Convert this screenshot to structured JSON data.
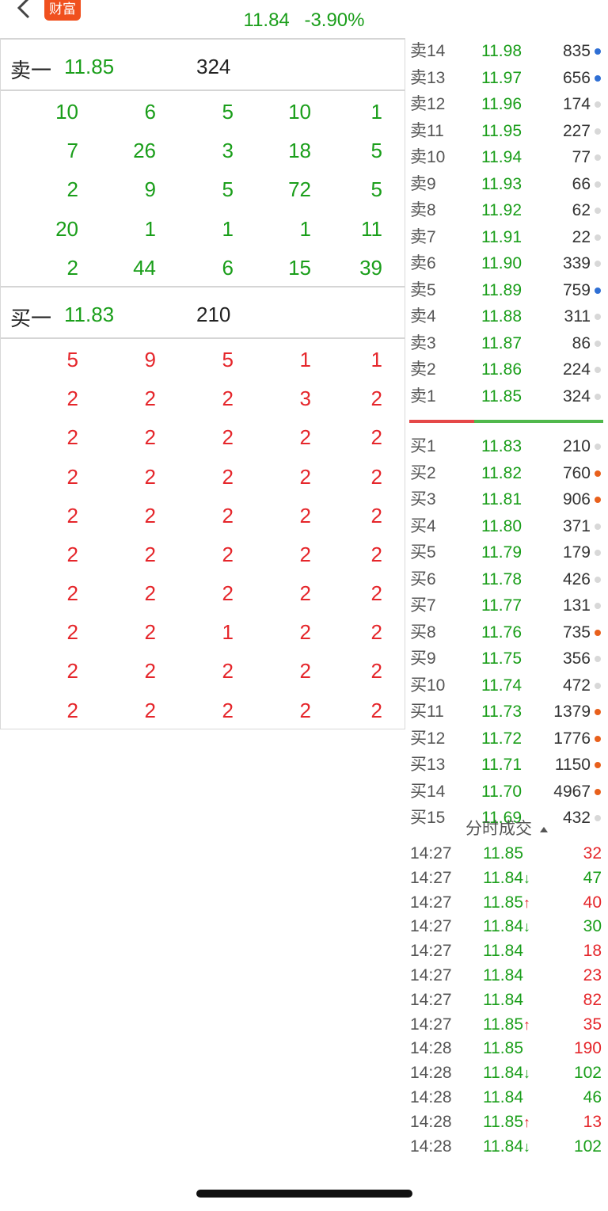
{
  "header": {
    "logo_text": "财富",
    "price": "11.84",
    "change": "-3.90%"
  },
  "sell1": {
    "label": "卖一",
    "price": "11.85",
    "volume": "324"
  },
  "buy1": {
    "label": "买一",
    "price": "11.83",
    "volume": "210"
  },
  "sell_grid": [
    [
      "10",
      "6",
      "5",
      "10",
      "1"
    ],
    [
      "7",
      "26",
      "3",
      "18",
      "5"
    ],
    [
      "2",
      "9",
      "5",
      "72",
      "5"
    ],
    [
      "20",
      "1",
      "1",
      "1",
      "11"
    ],
    [
      "2",
      "44",
      "6",
      "15",
      "39"
    ]
  ],
  "buy_grid": [
    [
      "5",
      "9",
      "5",
      "1",
      "1"
    ],
    [
      "2",
      "2",
      "2",
      "3",
      "2"
    ],
    [
      "2",
      "2",
      "2",
      "2",
      "2"
    ],
    [
      "2",
      "2",
      "2",
      "2",
      "2"
    ],
    [
      "2",
      "2",
      "2",
      "2",
      "2"
    ],
    [
      "2",
      "2",
      "2",
      "2",
      "2"
    ],
    [
      "2",
      "2",
      "2",
      "2",
      "2"
    ],
    [
      "2",
      "2",
      "1",
      "2",
      "2"
    ],
    [
      "2",
      "2",
      "2",
      "2",
      "2"
    ],
    [
      "2",
      "2",
      "2",
      "2",
      "2"
    ]
  ],
  "sell_ladder": [
    {
      "label": "卖14",
      "price": "11.98",
      "volume": "835",
      "dot": "blue"
    },
    {
      "label": "卖13",
      "price": "11.97",
      "volume": "656",
      "dot": "blue"
    },
    {
      "label": "卖12",
      "price": "11.96",
      "volume": "174",
      "dot": "gray"
    },
    {
      "label": "卖11",
      "price": "11.95",
      "volume": "227",
      "dot": "gray"
    },
    {
      "label": "卖10",
      "price": "11.94",
      "volume": "77",
      "dot": "gray"
    },
    {
      "label": "卖9",
      "price": "11.93",
      "volume": "66",
      "dot": "gray"
    },
    {
      "label": "卖8",
      "price": "11.92",
      "volume": "62",
      "dot": "gray"
    },
    {
      "label": "卖7",
      "price": "11.91",
      "volume": "22",
      "dot": "gray"
    },
    {
      "label": "卖6",
      "price": "11.90",
      "volume": "339",
      "dot": "gray"
    },
    {
      "label": "卖5",
      "price": "11.89",
      "volume": "759",
      "dot": "blue"
    },
    {
      "label": "卖4",
      "price": "11.88",
      "volume": "311",
      "dot": "gray"
    },
    {
      "label": "卖3",
      "price": "11.87",
      "volume": "86",
      "dot": "gray"
    },
    {
      "label": "卖2",
      "price": "11.86",
      "volume": "224",
      "dot": "gray"
    },
    {
      "label": "卖1",
      "price": "11.85",
      "volume": "324",
      "dot": "gray"
    }
  ],
  "buy_ladder": [
    {
      "label": "买1",
      "price": "11.83",
      "volume": "210",
      "dot": "gray"
    },
    {
      "label": "买2",
      "price": "11.82",
      "volume": "760",
      "dot": "orange"
    },
    {
      "label": "买3",
      "price": "11.81",
      "volume": "906",
      "dot": "orange"
    },
    {
      "label": "买4",
      "price": "11.80",
      "volume": "371",
      "dot": "gray"
    },
    {
      "label": "买5",
      "price": "11.79",
      "volume": "179",
      "dot": "gray"
    },
    {
      "label": "买6",
      "price": "11.78",
      "volume": "426",
      "dot": "gray"
    },
    {
      "label": "买7",
      "price": "11.77",
      "volume": "131",
      "dot": "gray"
    },
    {
      "label": "买8",
      "price": "11.76",
      "volume": "735",
      "dot": "orange"
    },
    {
      "label": "买9",
      "price": "11.75",
      "volume": "356",
      "dot": "gray"
    },
    {
      "label": "买10",
      "price": "11.74",
      "volume": "472",
      "dot": "gray"
    },
    {
      "label": "买11",
      "price": "11.73",
      "volume": "1379",
      "dot": "orange"
    },
    {
      "label": "买12",
      "price": "11.72",
      "volume": "1776",
      "dot": "orange"
    },
    {
      "label": "买13",
      "price": "11.71",
      "volume": "1150",
      "dot": "orange"
    },
    {
      "label": "买14",
      "price": "11.70",
      "volume": "4967",
      "dot": "orange"
    },
    {
      "label": "买15",
      "price": "11.69",
      "volume": "432",
      "dot": "gray"
    }
  ],
  "trades_title": "分时成交",
  "trades": [
    {
      "time": "14:27",
      "price": "11.85",
      "arrow": "",
      "volume": "32",
      "vcolor": "red"
    },
    {
      "time": "14:27",
      "price": "11.84",
      "arrow": "↓",
      "volume": "47",
      "vcolor": "green"
    },
    {
      "time": "14:27",
      "price": "11.85",
      "arrow": "↑",
      "volume": "40",
      "vcolor": "red"
    },
    {
      "time": "14:27",
      "price": "11.84",
      "arrow": "↓",
      "volume": "30",
      "vcolor": "green"
    },
    {
      "time": "14:27",
      "price": "11.84",
      "arrow": "",
      "volume": "18",
      "vcolor": "red"
    },
    {
      "time": "14:27",
      "price": "11.84",
      "arrow": "",
      "volume": "23",
      "vcolor": "red"
    },
    {
      "time": "14:27",
      "price": "11.84",
      "arrow": "",
      "volume": "82",
      "vcolor": "red"
    },
    {
      "time": "14:27",
      "price": "11.85",
      "arrow": "↑",
      "volume": "35",
      "vcolor": "red"
    },
    {
      "time": "14:28",
      "price": "11.85",
      "arrow": "",
      "volume": "190",
      "vcolor": "red"
    },
    {
      "time": "14:28",
      "price": "11.84",
      "arrow": "↓",
      "volume": "102",
      "vcolor": "green"
    },
    {
      "time": "14:28",
      "price": "11.84",
      "arrow": "",
      "volume": "46",
      "vcolor": "green"
    },
    {
      "time": "14:28",
      "price": "11.85",
      "arrow": "↑",
      "volume": "13",
      "vcolor": "red"
    },
    {
      "time": "14:28",
      "price": "11.84",
      "arrow": "↓",
      "volume": "102",
      "vcolor": "green"
    }
  ]
}
